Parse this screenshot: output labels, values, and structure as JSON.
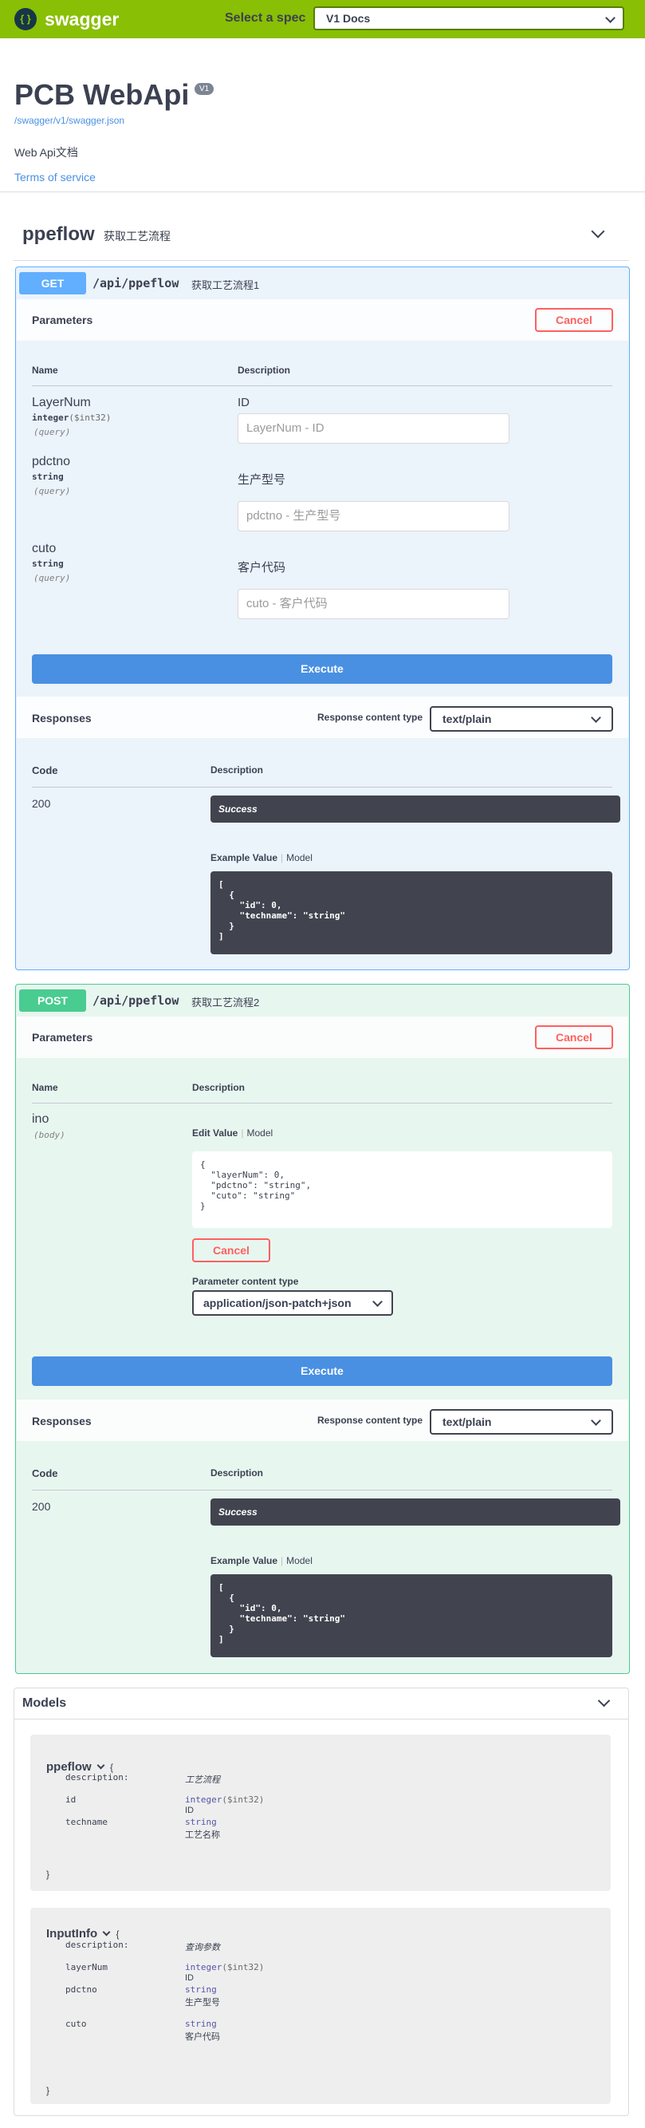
{
  "topbar": {
    "logo_glyph": "{ }",
    "logo_text": "swagger",
    "spec_label": "Select a spec",
    "spec_value": "V1 Docs"
  },
  "info": {
    "title": "PCB WebApi",
    "version": "V1",
    "url": "/swagger/v1/swagger.json",
    "description": "Web Api文档",
    "terms": "Terms of service"
  },
  "tag": {
    "name": "ppeflow",
    "description": "获取工艺流程"
  },
  "get_op": {
    "method": "GET",
    "path": "/api/ppeflow",
    "summary": "获取工艺流程1",
    "parameters_title": "Parameters",
    "cancel": "Cancel",
    "col_name": "Name",
    "col_description": "Description",
    "params": [
      {
        "name": "LayerNum",
        "type": "integer",
        "format": "($int32)",
        "in": "(query)",
        "description": "ID",
        "placeholder": "LayerNum - ID"
      },
      {
        "name": "pdctno",
        "type": "string",
        "format": "",
        "in": "(query)",
        "description": "生产型号",
        "placeholder": "pdctno - 生产型号"
      },
      {
        "name": "cuto",
        "type": "string",
        "format": "",
        "in": "(query)",
        "description": "客户代码",
        "placeholder": "cuto - 客户代码"
      }
    ],
    "execute": "Execute",
    "responses_title": "Responses",
    "response_content_type_label": "Response content type",
    "response_content_type": "text/plain",
    "code_header": "Code",
    "desc_header": "Description",
    "response_code": "200",
    "response_desc": "Success",
    "example_value": "Example Value",
    "model": "Model",
    "example_json": "[\n  {\n    \"id\": 0,\n    \"techname\": \"string\"\n  }\n]"
  },
  "post_op": {
    "method": "POST",
    "path": "/api/ppeflow",
    "summary": "获取工艺流程2",
    "parameters_title": "Parameters",
    "cancel": "Cancel",
    "col_name": "Name",
    "col_description": "Description",
    "param_name": "ino",
    "param_in": "(body)",
    "edit_value": "Edit Value",
    "model": "Model",
    "body_json": "{\n  \"layerNum\": 0,\n  \"pdctno\": \"string\",\n  \"cuto\": \"string\"\n}",
    "body_cancel": "Cancel",
    "param_content_type_label": "Parameter content type",
    "param_content_type": "application/json-patch+json",
    "execute": "Execute",
    "responses_title": "Responses",
    "response_content_type_label": "Response content type",
    "response_content_type": "text/plain",
    "code_header": "Code",
    "desc_header": "Description",
    "response_code": "200",
    "response_desc": "Success",
    "example_value": "Example Value",
    "example_json": "[\n  {\n    \"id\": 0,\n    \"techname\": \"string\"\n  }\n]"
  },
  "models": {
    "title": "Models",
    "ppeflow": {
      "name": "ppeflow",
      "open_brace": "{",
      "close_brace": "}",
      "description_key": "description:",
      "description": "工艺流程",
      "props": [
        {
          "key": "id",
          "type": "integer",
          "format": "($int32)",
          "desc": "ID"
        },
        {
          "key": "techname",
          "type": "string",
          "format": "",
          "desc": "工艺名称"
        }
      ]
    },
    "inputinfo": {
      "name": "InputInfo",
      "open_brace": "{",
      "close_brace": "}",
      "description_key": "description:",
      "description": "查询参数",
      "props": [
        {
          "key": "layerNum",
          "type": "integer",
          "format": "($int32)",
          "desc": "ID"
        },
        {
          "key": "pdctno",
          "type": "string",
          "format": "",
          "desc": "生产型号"
        },
        {
          "key": "cuto",
          "type": "string",
          "format": "",
          "desc": "客户代码"
        }
      ]
    }
  },
  "colors": {
    "topbar": "#89bf04",
    "get": "#61affe",
    "post": "#49cc90",
    "execute": "#4990e2",
    "cancel": "#ff6060",
    "dark": "#41444e"
  }
}
